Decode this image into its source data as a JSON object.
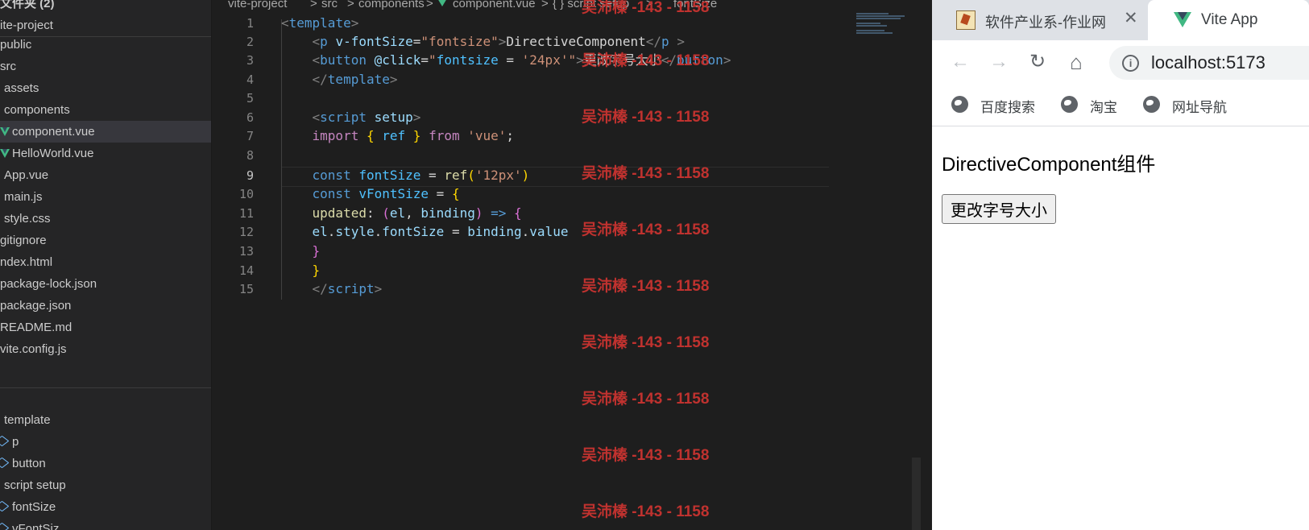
{
  "explorer": {
    "items": [
      {
        "label": "文件夹 (2)",
        "kind": "header"
      },
      {
        "label": "ite-project",
        "kind": "folder"
      },
      {
        "label": "public",
        "kind": "folder"
      },
      {
        "label": "src",
        "kind": "folder"
      },
      {
        "label": "assets",
        "kind": "folder"
      },
      {
        "label": "components",
        "kind": "folder"
      },
      {
        "label": "component.vue",
        "kind": "vue",
        "selected": true
      },
      {
        "label": "HelloWorld.vue",
        "kind": "vue"
      },
      {
        "label": "App.vue",
        "kind": "file"
      },
      {
        "label": "main.js",
        "kind": "file"
      },
      {
        "label": "style.css",
        "kind": "file"
      },
      {
        "label": "gitignore",
        "kind": "file"
      },
      {
        "label": "ndex.html",
        "kind": "file"
      },
      {
        "label": "package-lock.json",
        "kind": "file"
      },
      {
        "label": "package.json",
        "kind": "file"
      },
      {
        "label": "README.md",
        "kind": "file"
      },
      {
        "label": "vite.config.js",
        "kind": "file"
      }
    ],
    "outline": [
      {
        "label": "template",
        "icon": "none"
      },
      {
        "label": "p",
        "icon": "symbol-icon"
      },
      {
        "label": "button",
        "icon": "symbol-icon"
      },
      {
        "label": "script setup",
        "icon": "none"
      },
      {
        "label": "fontSize",
        "icon": "symbol-icon"
      },
      {
        "label": "vFontSiz",
        "icon": "symbol-icon"
      }
    ]
  },
  "breadcrumb": {
    "parts": [
      "vite-project",
      ">",
      "src",
      ">",
      "components",
      ">",
      "component.vue",
      ">",
      "{ } script setup",
      ">",
      "fontSize"
    ]
  },
  "editor": {
    "line_numbers": [
      "1",
      "2",
      "3",
      "4",
      "5",
      "6",
      "7",
      "8",
      "9",
      "10",
      "11",
      "12",
      "13",
      "14",
      "15"
    ],
    "active_line": "9",
    "watermark": "吴沛榛 -143 - 1158"
  },
  "browser": {
    "tabs": [
      {
        "title": "软件产业系-作业网",
        "close": "✕"
      },
      {
        "title": "Vite App"
      }
    ],
    "nav": {
      "back": "←",
      "forward": "→",
      "reload": "↻",
      "home": "⌂"
    },
    "info_glyph": "i",
    "url": "localhost:5173",
    "bookmarks": [
      "百度搜索",
      "淘宝",
      "网址导航"
    ],
    "page": {
      "heading": "DirectiveComponent组件",
      "button_label": "更改字号大小"
    }
  }
}
